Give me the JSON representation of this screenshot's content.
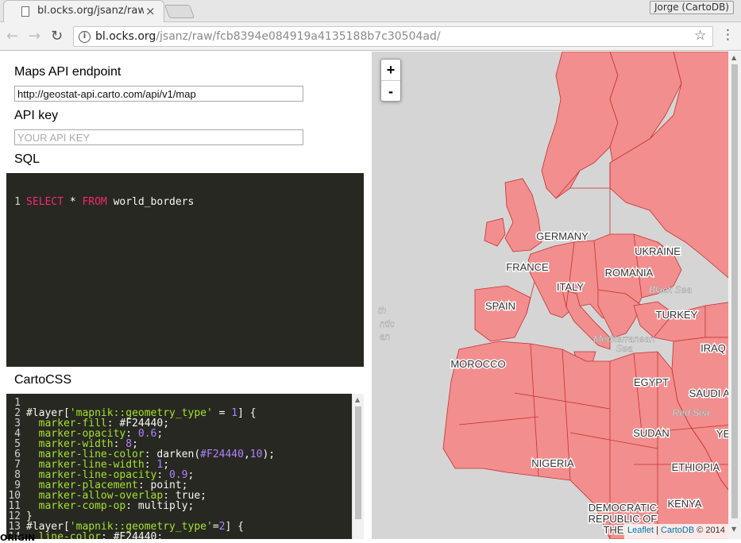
{
  "browser": {
    "tab_title": "bl.ocks.org/jsanz/raw",
    "tab_close": "×",
    "profile_name": "Jorge (CartoDB)",
    "url_host": "bl.ocks.org",
    "url_path": "/jsanz/raw/fcb8394e084919a4135188b7c30504ad/",
    "back_icon": "←",
    "forward_icon": "→",
    "reload_icon": "↻",
    "star_icon": "☆",
    "menu_icon": "⋮"
  },
  "form": {
    "endpoint_label": "Maps API endpoint",
    "endpoint_value": "http://geostat-api.carto.com/api/v1/map",
    "apikey_label": "API key",
    "apikey_placeholder": "YOUR API KEY",
    "sql_label": "SQL",
    "cartocss_label": "CartoCSS"
  },
  "sql_editor": {
    "line_number": "1",
    "keyword_select": "SELECT",
    "star": " * ",
    "keyword_from": "FROM",
    "table": " world_borders"
  },
  "cartocss_editor": {
    "lines": [
      {
        "n": "1",
        "parts": []
      },
      {
        "n": "2",
        "parts": [
          [
            "",
            "#layer["
          ],
          [
            "str",
            "'mapnik::geometry_type'"
          ],
          [
            "",
            " = "
          ],
          [
            "num",
            "1"
          ],
          [
            "",
            "] {"
          ]
        ]
      },
      {
        "n": "3",
        "parts": [
          [
            "",
            "  "
          ],
          [
            "prop",
            "marker-fill"
          ],
          [
            "",
            ": #F24440;"
          ]
        ]
      },
      {
        "n": "4",
        "parts": [
          [
            "",
            "  "
          ],
          [
            "prop",
            "marker-opacity"
          ],
          [
            "",
            ": "
          ],
          [
            "num",
            "0.6"
          ],
          [
            "",
            ";"
          ]
        ]
      },
      {
        "n": "5",
        "parts": [
          [
            "",
            "  "
          ],
          [
            "prop",
            "marker-width"
          ],
          [
            "",
            ": "
          ],
          [
            "num",
            "8"
          ],
          [
            "",
            ";"
          ]
        ]
      },
      {
        "n": "6",
        "parts": [
          [
            "",
            "  "
          ],
          [
            "prop",
            "marker-line-color"
          ],
          [
            "",
            ": darken("
          ],
          [
            "num",
            "#F24440"
          ],
          [
            "",
            ","
          ],
          [
            "num",
            "10"
          ],
          [
            "",
            ");"
          ]
        ]
      },
      {
        "n": "7",
        "parts": [
          [
            "",
            "  "
          ],
          [
            "prop",
            "marker-line-width"
          ],
          [
            "",
            ": "
          ],
          [
            "num",
            "1"
          ],
          [
            "",
            ";"
          ]
        ]
      },
      {
        "n": "8",
        "parts": [
          [
            "",
            "  "
          ],
          [
            "prop",
            "marker-line-opacity"
          ],
          [
            "",
            ": "
          ],
          [
            "num",
            "0.9"
          ],
          [
            "",
            ";"
          ]
        ]
      },
      {
        "n": "9",
        "parts": [
          [
            "",
            "  "
          ],
          [
            "prop",
            "marker-placement"
          ],
          [
            "",
            ": point;"
          ]
        ]
      },
      {
        "n": "10",
        "parts": [
          [
            "",
            "  "
          ],
          [
            "prop",
            "marker-allow-overlap"
          ],
          [
            "",
            ": true;"
          ]
        ]
      },
      {
        "n": "11",
        "parts": [
          [
            "",
            "  "
          ],
          [
            "prop",
            "marker-comp-op"
          ],
          [
            "",
            ": multiply;"
          ]
        ]
      },
      {
        "n": "12",
        "parts": [
          [
            "",
            "}"
          ]
        ]
      },
      {
        "n": "13",
        "parts": [
          [
            "",
            "#layer["
          ],
          [
            "str",
            "'mapnik::geometry_type'"
          ],
          [
            "",
            "="
          ],
          [
            "num",
            "2"
          ],
          [
            "",
            "] {"
          ]
        ]
      },
      {
        "n": "14",
        "parts": [
          [
            "",
            "  "
          ],
          [
            "prop",
            "line-color"
          ],
          [
            "",
            ": #F24440;"
          ]
        ]
      }
    ]
  },
  "map": {
    "zoom_in": "+",
    "zoom_out": "-",
    "attribution_leaflet": "Leaflet",
    "attribution_sep": " | ",
    "attribution_cartodb": "CartoDB",
    "attribution_year": " © 2014",
    "land_color": "#F28E8E",
    "border_color": "#C82F2F",
    "water_color": "#D5D5D5",
    "country_labels": [
      "GERMANY",
      "UKRAINE",
      "FRANCE",
      "ROMANIA",
      "ITALY",
      "SPAIN",
      "TURKEY",
      "MOROCCO",
      "IRAQ",
      "EGYPT",
      "SAUDI AR",
      "SUDAN",
      "YEM",
      "NIGERIA",
      "ETHIOPIA",
      "KENYA",
      "DEMOCRATIC",
      "REPUBLIC OF",
      "THE CO"
    ],
    "sea_labels": [
      "Black Sea",
      "Mediterranean",
      "Sea",
      "Red Sea",
      "th",
      "ntic",
      "an"
    ]
  },
  "footer_clip": "ORIGIN"
}
